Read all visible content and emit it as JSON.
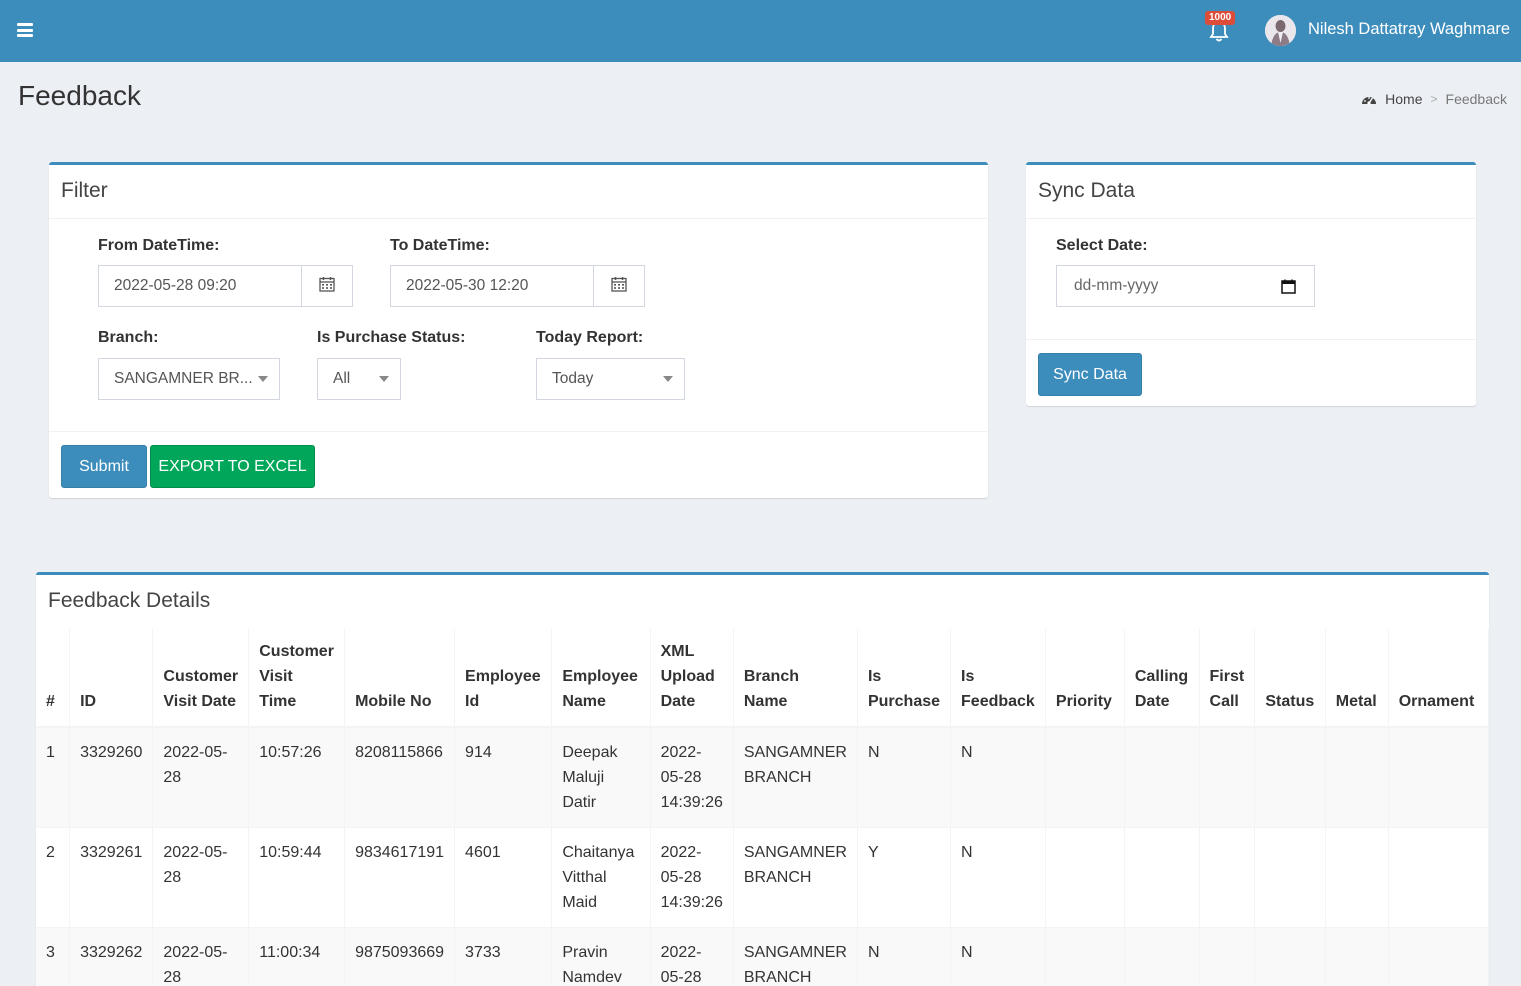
{
  "header": {
    "notification_count": "1000",
    "user_name": "Nilesh Dattatray Waghmare"
  },
  "page": {
    "title": "Feedback",
    "breadcrumb": {
      "home": "Home",
      "separator": ">",
      "current": "Feedback"
    }
  },
  "filter": {
    "title": "Filter",
    "from_label": "From DateTime:",
    "from_value": "2022-05-28 09:20",
    "to_label": "To DateTime:",
    "to_value": "2022-05-30 12:20",
    "branch_label": "Branch:",
    "branch_value": "SANGAMNER BR...",
    "purchase_label": "Is Purchase Status:",
    "purchase_value": "All",
    "today_label": "Today Report:",
    "today_value": "Today",
    "submit_label": "Submit",
    "export_label": "EXPORT TO EXCEL"
  },
  "sync": {
    "title": "Sync Data",
    "date_label": "Select Date:",
    "date_placeholder": "dd-mm-yyyy",
    "button_label": "Sync Data"
  },
  "details": {
    "title": "Feedback Details",
    "columns": [
      "#",
      "ID",
      "Customer Visit Date",
      "Customer Visit Time",
      "Mobile No",
      "Employee Id",
      "Employee Name",
      "XML Upload Date",
      "Branch Name",
      "Is Purchase",
      "Is Feedback",
      "Priority",
      "Calling Date",
      "First Call",
      "Status",
      "Metal",
      "Ornament"
    ],
    "rows": [
      [
        "1",
        "3329260",
        "2022-05-28",
        "10:57:26",
        "8208115866",
        "914",
        "Deepak Maluji Datir",
        "2022-05-28 14:39:26",
        "SANGAMNER BRANCH",
        "N",
        "N",
        "",
        "",
        "",
        "",
        "",
        ""
      ],
      [
        "2",
        "3329261",
        "2022-05-28",
        "10:59:44",
        "9834617191",
        "4601",
        "Chaitanya Vitthal Maid",
        "2022-05-28 14:39:26",
        "SANGAMNER BRANCH",
        "Y",
        "N",
        "",
        "",
        "",
        "",
        "",
        ""
      ],
      [
        "3",
        "3329262",
        "2022-05-28",
        "11:00:34",
        "9875093669",
        "3733",
        "Pravin Namdev",
        "2022-05-28",
        "SANGAMNER BRANCH",
        "N",
        "N",
        "",
        "",
        "",
        "",
        "",
        ""
      ]
    ]
  },
  "colors": {
    "header_bg": "#3c8dbc",
    "primary": "#3c8dbc",
    "success": "#00a65a",
    "badge": "#dd4b39",
    "page_bg": "#ecf0f5"
  }
}
